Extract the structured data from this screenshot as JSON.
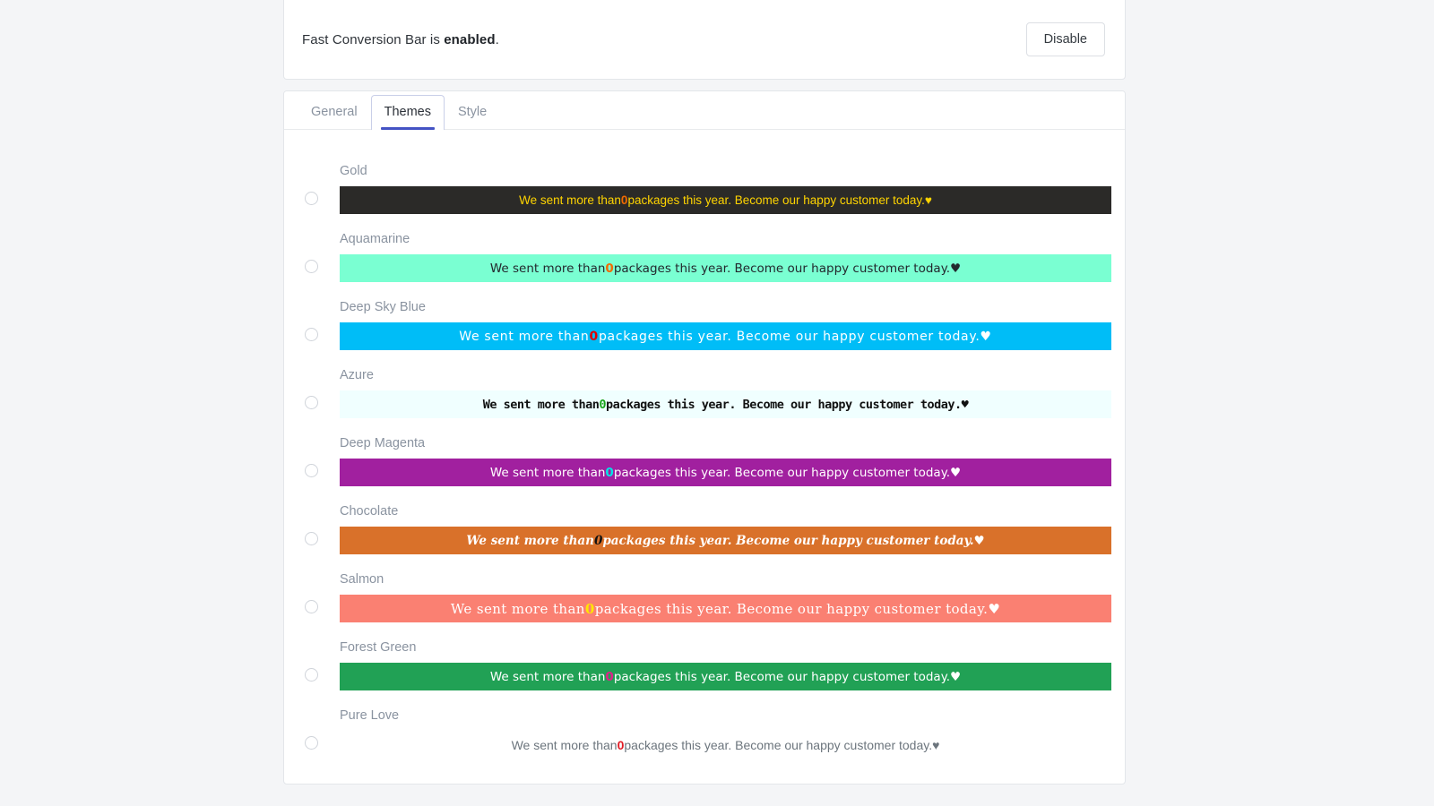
{
  "status_card": {
    "message_prefix": "Fast Conversion Bar is ",
    "message_state": "enabled",
    "message_suffix": ".",
    "disable_label": "Disable"
  },
  "tabs": [
    {
      "label": "General",
      "active": false
    },
    {
      "label": "Themes",
      "active": true
    },
    {
      "label": "Style",
      "active": false
    }
  ],
  "bar_message": {
    "before": "We sent more than ",
    "number": "0",
    "after": " packages this year. Become our happy customer today. ",
    "heart": "♥"
  },
  "themes": [
    {
      "label": "Gold",
      "key": "t-gold",
      "bg": "#2b2a28",
      "text": "#ffd400",
      "num": "#f26a00",
      "selected": false
    },
    {
      "label": "Aquamarine",
      "key": "t-aqua",
      "bg": "#7affd2",
      "text": "#23282d",
      "num": "#f26a00",
      "selected": false
    },
    {
      "label": "Deep Sky Blue",
      "key": "t-dsb",
      "bg": "#00bdf7",
      "text": "#ffffff",
      "num": "#e00000",
      "selected": false
    },
    {
      "label": "Azure",
      "key": "t-azure",
      "bg": "#f0ffff",
      "text": "#111111",
      "num": "#19a319",
      "selected": false
    },
    {
      "label": "Deep Magenta",
      "key": "t-magenta",
      "bg": "#a1209f",
      "text": "#ffffff",
      "num": "#00e5e5",
      "selected": false
    },
    {
      "label": "Chocolate",
      "key": "t-choco",
      "bg": "#d9712a",
      "text": "#ffffff",
      "num": "#111111",
      "selected": false
    },
    {
      "label": "Salmon",
      "key": "t-salmon",
      "bg": "#fa8072",
      "text": "#ffffff",
      "num": "#ffe600",
      "selected": false
    },
    {
      "label": "Forest Green",
      "key": "t-forest",
      "bg": "#21a155",
      "text": "#ffffff",
      "num": "#e0218a",
      "selected": false
    },
    {
      "label": "Pure Love",
      "key": "t-pure",
      "bg": "transparent",
      "text": "#6c757d",
      "num": "#e01b24",
      "selected": false
    }
  ],
  "colors": {
    "page_background": "#f4f5f7",
    "card_background": "#ffffff",
    "card_border": "#e3e6ea",
    "accent": "#4453c4",
    "muted_text": "#8a93a0"
  }
}
